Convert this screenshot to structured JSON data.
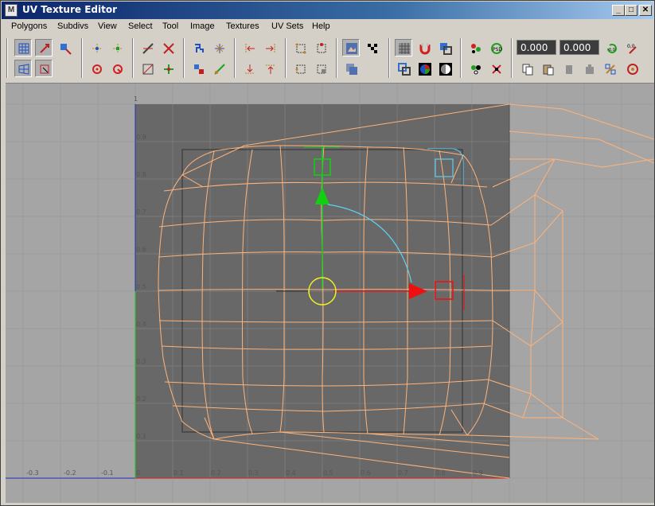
{
  "window": {
    "title": "UV Texture Editor",
    "minimize_label": "_",
    "maximize_label": "□",
    "close_label": "✕"
  },
  "menu": {
    "items": [
      "Polygons",
      "Subdivs",
      "View",
      "Select",
      "Tool",
      "Image",
      "Textures",
      "UV Sets",
      "Help"
    ]
  },
  "toolbar": {
    "u_value": "0.000",
    "v_value": "0.000",
    "icons": [
      "uv-grid-select-icon",
      "move-uv-icon",
      "uv-shell-select-icon",
      "uv-lattice-icon",
      "uv-smudge-icon",
      "flip-u-icon",
      "flip-v-icon",
      "rotate-ccw-icon",
      "rotate-cw-icon",
      "cut-uv-icon",
      "sew-uv-icon",
      "split-uv-icon",
      "merge-uv-icon",
      "layout-uv-icon",
      "unfold-uv-icon",
      "align-min-u-icon",
      "align-max-u-icon",
      "align-min-v-icon",
      "align-max-v-icon",
      "snap-grid-icon",
      "snap-uv-icon",
      "isolate-select-icon",
      "add-to-isolate-icon",
      "display-image-icon",
      "checker-icon",
      "grid-toggle-icon",
      "magnet-icon",
      "texture-border-icon",
      "shaded-uv-icon",
      "color-channels-icon",
      "dim-image-icon",
      "psd-update-icon",
      "psd-network-icon",
      "copy-uv-icon",
      "paste-uv-icon",
      "paste-u-icon",
      "paste-v-icon",
      "cycle-uv-icon",
      "uv-zero-icon",
      "uv-percent-icon",
      "uv-refresh-icon",
      "uv-swap-icon"
    ]
  },
  "viewport": {
    "x_tick_labels": [
      "-0.3",
      "-0.2",
      "-0.1",
      "0",
      "0.1",
      "0.2",
      "0.3",
      "0.4",
      "0.5",
      "0.6",
      "0.7",
      "0.8",
      "0.9"
    ],
    "y_tick_labels": [
      "1",
      "0.9",
      "0.8",
      "0.7",
      "0.6",
      "0.5",
      "0.4",
      "0.3",
      "0.2",
      "0.1"
    ],
    "texture_color": "#686868",
    "background_color": "#a5a5a5",
    "wire_color": "#ffb37a",
    "u_axis_color": "#d81e1e",
    "v_axis_color": "#1ec81e"
  }
}
